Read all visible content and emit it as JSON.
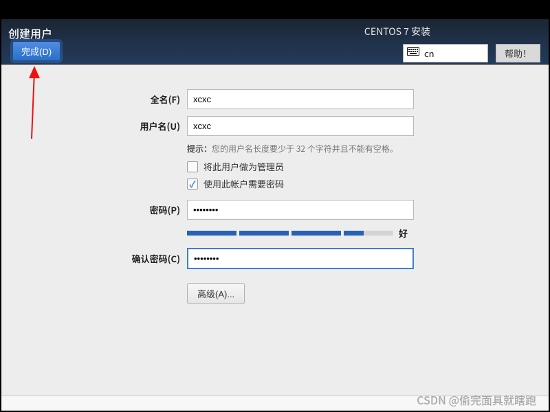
{
  "header": {
    "title": "创建用户",
    "done_label": "完成(D)",
    "installer_title": "CENTOS 7 安装",
    "lang_code": "cn",
    "help_label": "帮助！"
  },
  "form": {
    "full_name_label": "全名(F)",
    "full_name_value": "xcxc",
    "user_name_label": "用户名(U)",
    "user_name_value": "xcxc",
    "hint_prefix": "提示：",
    "hint_text": "您的用户名长度要少于 32 个字符并且不能有空格。",
    "admin_checkbox_label": "将此用户做为管理员",
    "admin_checked": false,
    "require_password_label": "使用此帐户需要密码",
    "require_password_checked": true,
    "password_label": "密码(P)",
    "password_value": "••••••••",
    "strength_label": "好",
    "confirm_password_label": "确认密码(C)",
    "confirm_password_value": "••••••••",
    "advanced_label": "高级(A)..."
  },
  "watermark": "CSDN @偷完面具就瞎跑"
}
